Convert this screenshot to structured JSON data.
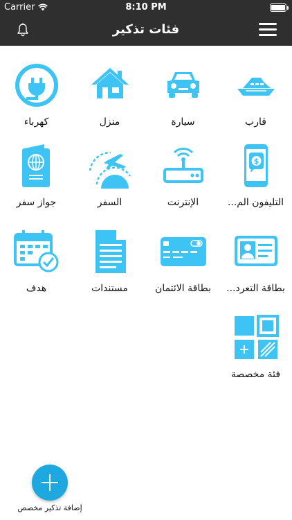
{
  "status_bar": {
    "carrier": "Carrier",
    "time": "8:10 PM"
  },
  "nav": {
    "title": "فئات تذكير"
  },
  "categories": [
    {
      "label": "قارب",
      "icon": "boat-icon"
    },
    {
      "label": "سيارة",
      "icon": "car-icon"
    },
    {
      "label": "منزل",
      "icon": "house-icon"
    },
    {
      "label": "كهرباء",
      "icon": "electricity-plug-icon"
    },
    {
      "label": "التليفون الم...",
      "icon": "mobile-phone-icon"
    },
    {
      "label": "الإنترنت",
      "icon": "router-icon"
    },
    {
      "label": "السفر",
      "icon": "travel-plane-icon"
    },
    {
      "label": "جواز سفر",
      "icon": "passport-icon"
    },
    {
      "label": "بطاقة التعرد...",
      "icon": "id-card-icon"
    },
    {
      "label": "بطاقة الائتمان",
      "icon": "credit-card-icon"
    },
    {
      "label": "مستندات",
      "icon": "document-icon"
    },
    {
      "label": "هدف",
      "icon": "calendar-check-icon"
    },
    {
      "label": "فئة مخصصة",
      "icon": "custom-category-icon"
    }
  ],
  "add_button": {
    "label": "إضافة تذكير مخصص"
  },
  "colors": {
    "accent": "#1fa8e0",
    "icon_blue": "#3dc4f5",
    "bar": "#2f2f2f"
  }
}
